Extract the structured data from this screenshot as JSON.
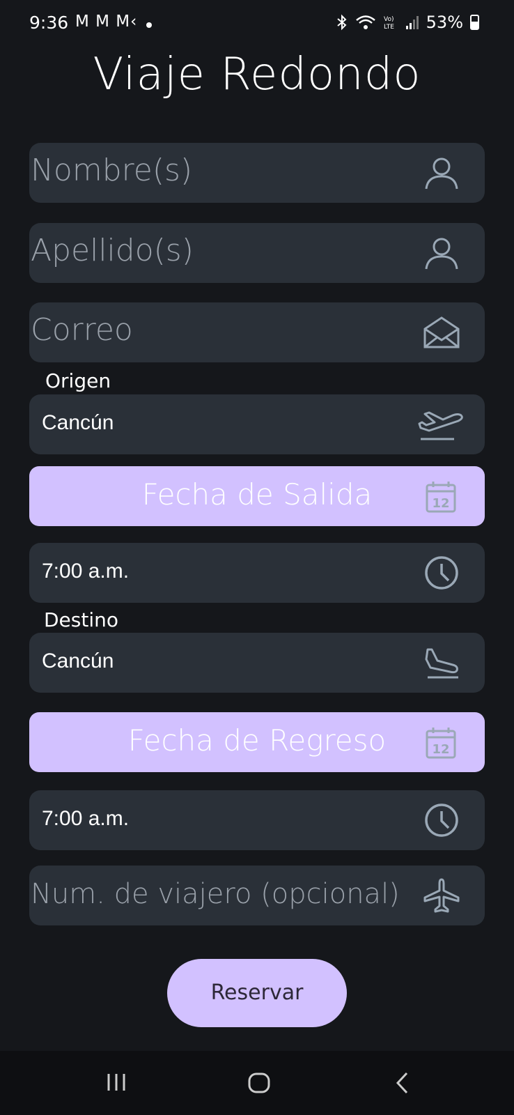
{
  "status_bar": {
    "time": "9:36",
    "apps": "M M M‹",
    "battery": "53%"
  },
  "page": {
    "title": "Viaje Redondo"
  },
  "form": {
    "first_name": {
      "placeholder": "Nombre(s)",
      "icon": "person-icon"
    },
    "last_name": {
      "placeholder": "Apellido(s)",
      "icon": "person-icon"
    },
    "email": {
      "placeholder": "Correo",
      "icon": "mail-icon"
    },
    "origin": {
      "label": "Origen",
      "value": "Cancún",
      "icon": "takeoff-icon"
    },
    "departure_date": {
      "label": "Fecha de Salida",
      "icon": "calendar-icon",
      "calendar_day": "12"
    },
    "departure_time": {
      "value": "7:00 a.m.",
      "icon": "clock-icon"
    },
    "destination": {
      "label": "Destino",
      "value": "Cancún",
      "icon": "landing-icon"
    },
    "return_date": {
      "label": "Fecha de Regreso",
      "icon": "calendar-icon",
      "calendar_day": "12"
    },
    "return_time": {
      "value": "7:00 a.m.",
      "icon": "clock-icon"
    },
    "travelers": {
      "placeholder": "Num. de viajero (opcional)",
      "icon": "airplane-icon"
    }
  },
  "actions": {
    "reserve_label": "Reservar"
  },
  "colors": {
    "background": "#15171b",
    "field": "#2a3038",
    "accent": "#d2c1ff",
    "icon": "#9aa8b6"
  }
}
